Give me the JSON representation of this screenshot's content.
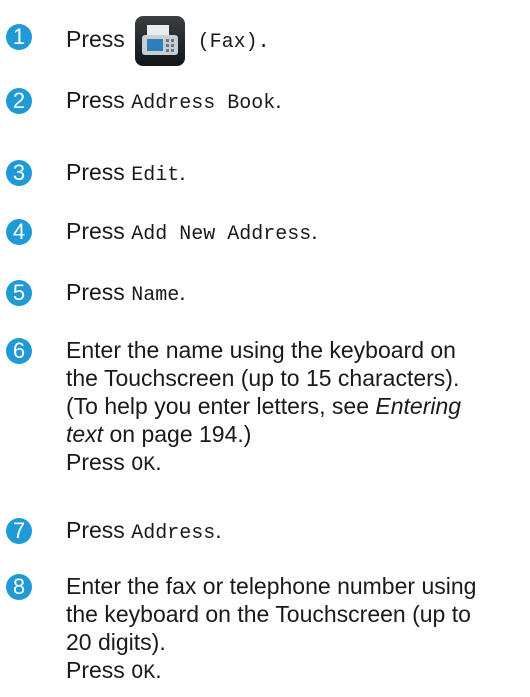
{
  "accent_color": "#1f9ad6",
  "icons": [
    "fax-icon"
  ],
  "steps": [
    {
      "number": "1",
      "press": "Press",
      "code": "(Fax).",
      "icon": "fax-icon"
    },
    {
      "number": "2",
      "press": "Press",
      "code": "Address Book",
      "tail": "."
    },
    {
      "number": "3",
      "press": "Press",
      "code": "Edit",
      "tail": "."
    },
    {
      "number": "4",
      "press": "Press",
      "code": "Add New Address",
      "tail": "."
    },
    {
      "number": "5",
      "press": "Press",
      "code": "Name",
      "tail": "."
    },
    {
      "number": "6",
      "line1": "Enter the name using the keyboard on",
      "line2": "the Touchscreen (up to 15 characters).",
      "line3a": "(To help you enter letters, see ",
      "line3b": "Entering",
      "line4a": "text",
      "line4b": " on page 194.)",
      "press": "Press",
      "code": "OK",
      "tail": "."
    },
    {
      "number": "7",
      "press": "Press",
      "code": "Address",
      "tail": "."
    },
    {
      "number": "8",
      "line1": "Enter the fax or telephone number using",
      "line2": "the keyboard on the Touchscreen (up to",
      "line3": "20 digits).",
      "press": "Press",
      "code": "OK",
      "tail": "."
    }
  ]
}
